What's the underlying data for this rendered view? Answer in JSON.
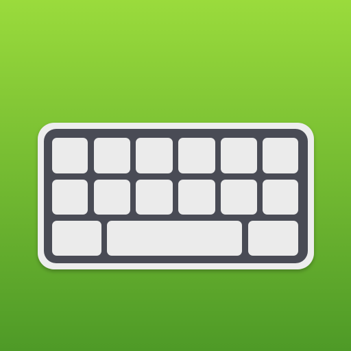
{
  "icon": {
    "name": "keyboard-icon",
    "rows": [
      6,
      6,
      3
    ]
  },
  "colors": {
    "background_top": "#9ADB3C",
    "background_bottom": "#4E9A27",
    "outer_frame": "#EDEDED",
    "keyboard_body": "#4A4C55",
    "key_face": "#EBEBEB",
    "key_face_light": "#F2F2F2"
  }
}
